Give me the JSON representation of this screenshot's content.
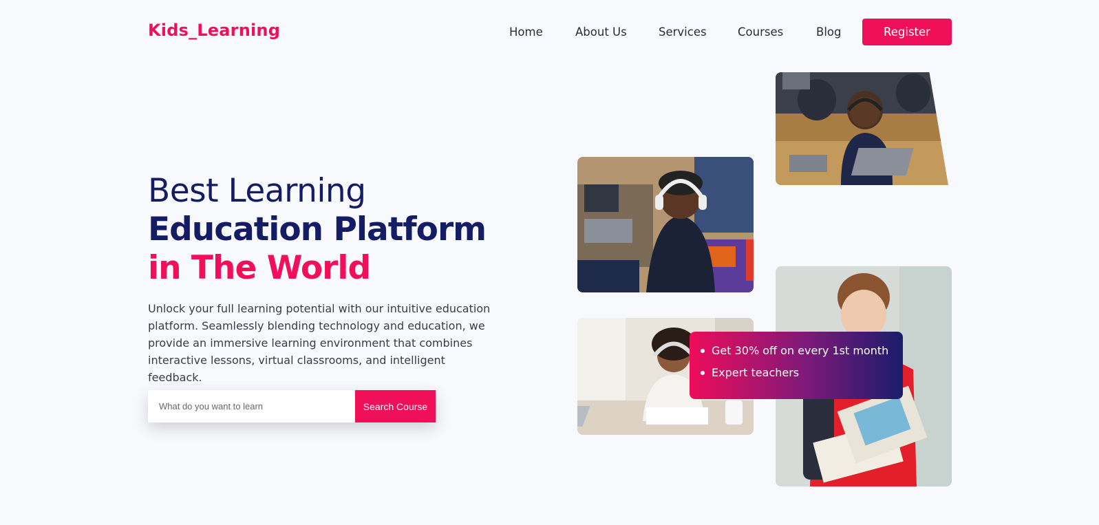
{
  "brand": {
    "logo": "Kids_Learning"
  },
  "nav": {
    "items": [
      "Home",
      "About Us",
      "Services",
      "Courses",
      "Blog"
    ],
    "register_label": "Register"
  },
  "hero": {
    "line1": "Best Learning",
    "line2": "Education Platform",
    "line3": "in The World",
    "description": "Unlock your full learning potential with our intuitive education platform. Seamlessly blending technology and education, we provide an immersive learning environment that combines interactive lessons, virtual classrooms, and intelligent feedback."
  },
  "search": {
    "placeholder": "What do you want to learn",
    "button_label": "Search Course"
  },
  "offer": {
    "items": [
      "Get 30% off on every 1st month",
      "Expert teachers"
    ]
  },
  "colors": {
    "accent": "#f0105a",
    "navy": "#141c64",
    "background": "#f8f9fd"
  }
}
